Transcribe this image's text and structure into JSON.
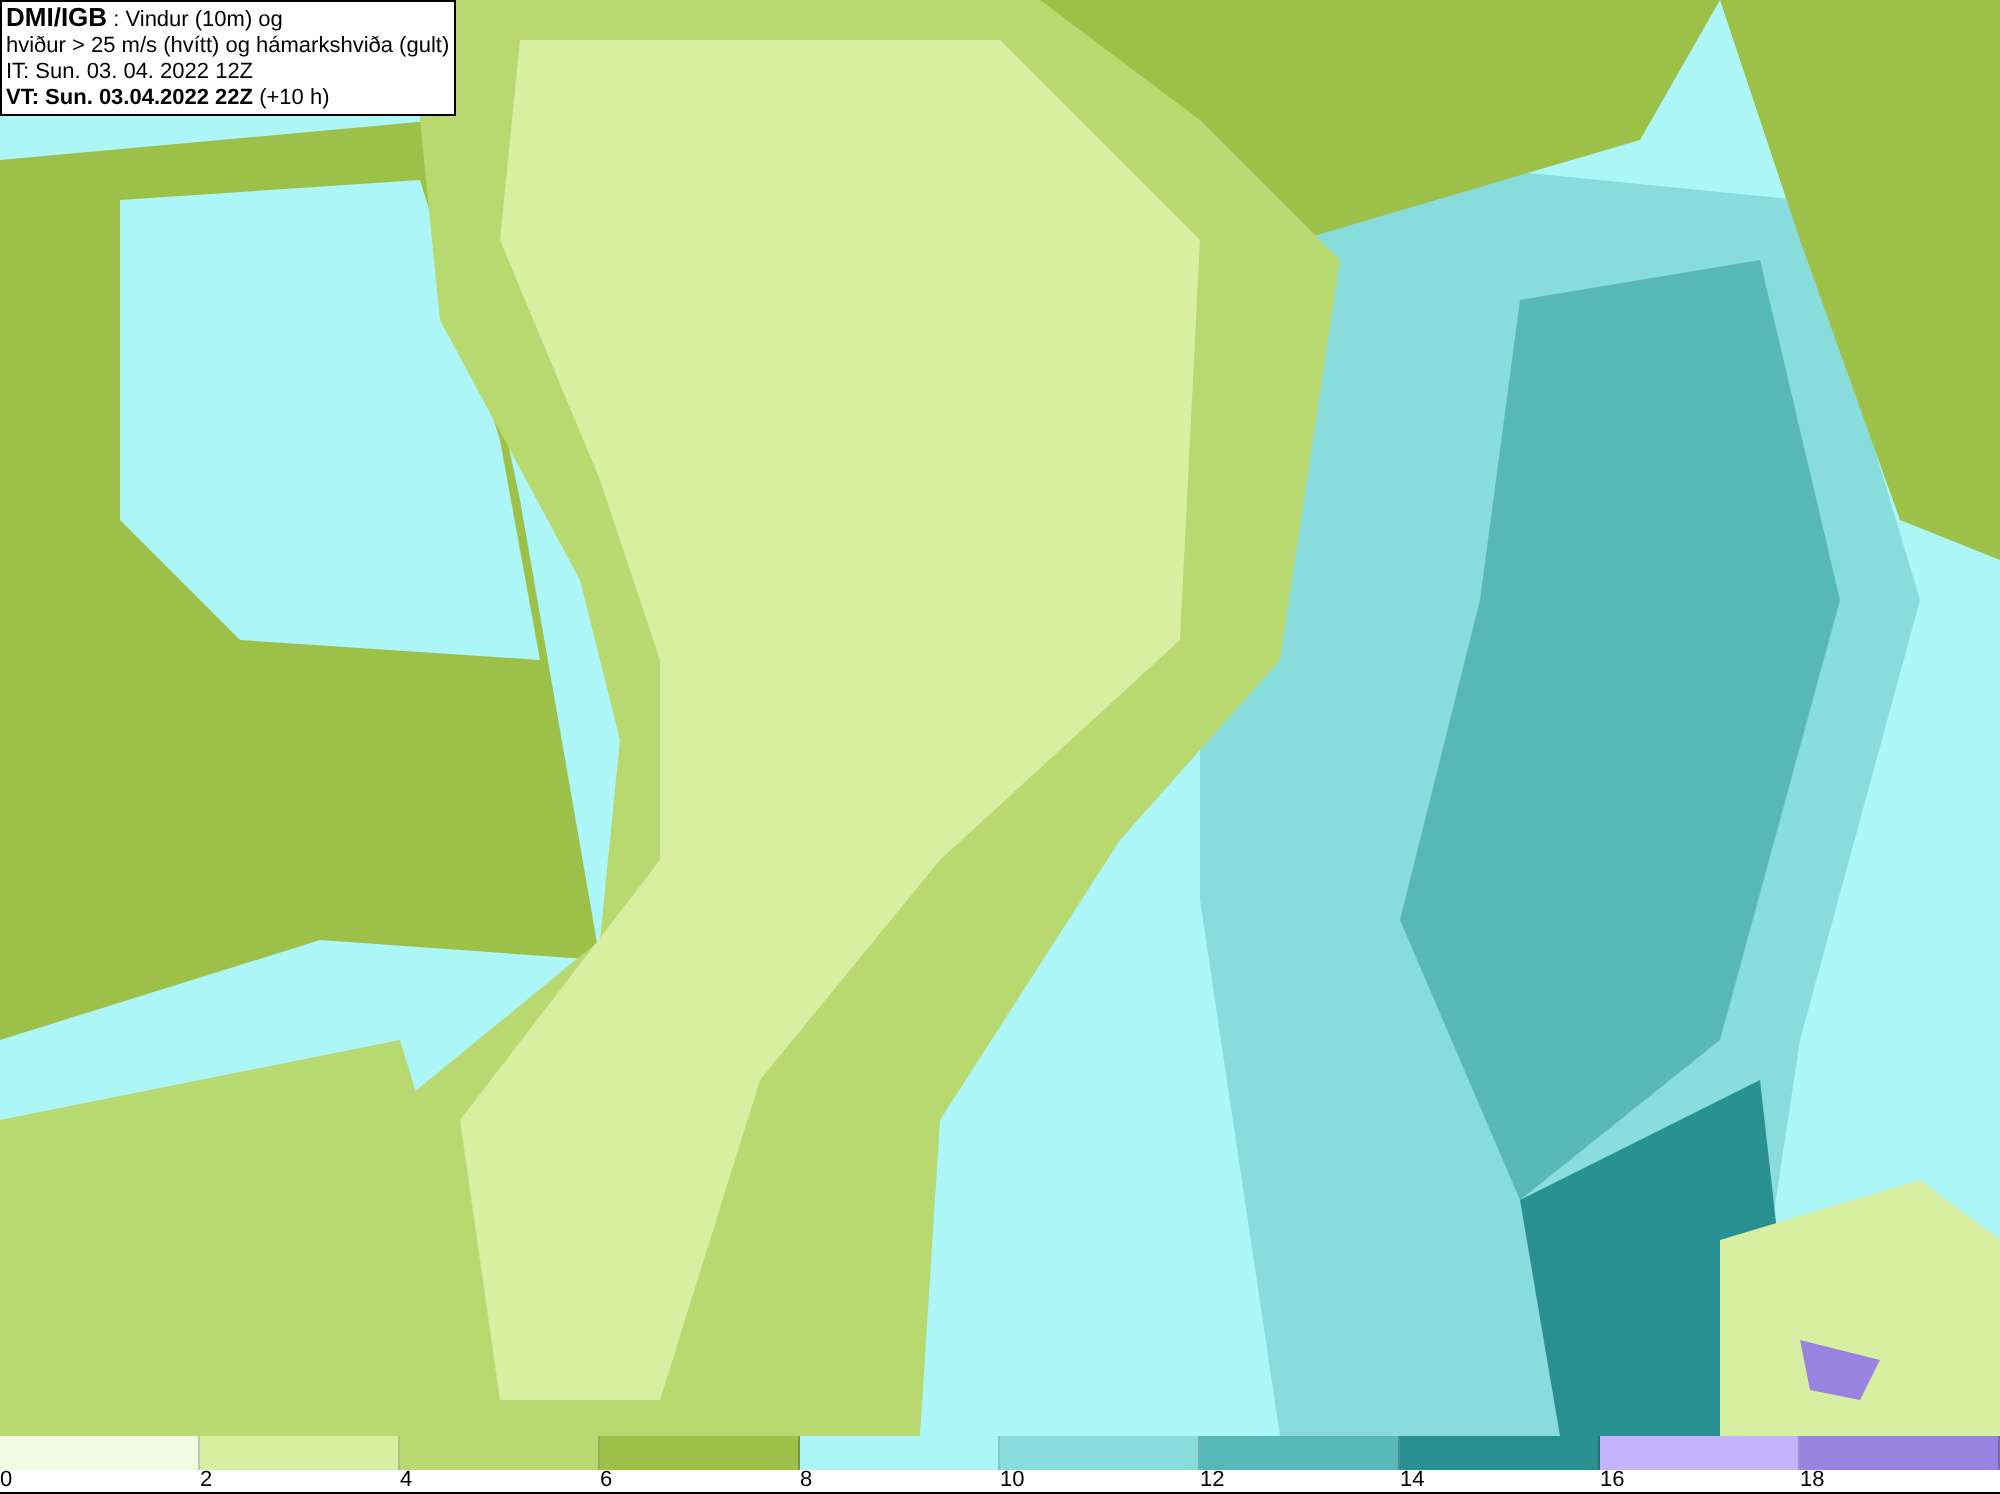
{
  "header": {
    "lines": [
      "**DMI/IGB** : Vindur (10m) og",
      "hviður > 25 m/s (hvítt) og hámarkshviða (gult)",
      "IT: Sun. 03. 04. 2022 12Z",
      "**VT: Sun. 03.04.2022 22Z** (+10 h)"
    ]
  },
  "legend": [
    {
      "label": "0",
      "color": "#f4fae2"
    },
    {
      "label": "2",
      "color": "#d8eea0"
    },
    {
      "label": "4",
      "color": "#b8d870"
    },
    {
      "label": "6",
      "color": "#9cc048"
    },
    {
      "label": "8",
      "color": "#acf6f8"
    },
    {
      "label": "10",
      "color": "#88dcdc"
    },
    {
      "label": "12",
      "color": "#58b8b8"
    },
    {
      "label": "14",
      "color": "#289090"
    },
    {
      "label": "16",
      "color": "#c4b4fc"
    },
    {
      "label": "18",
      "color": "#9884e0"
    }
  ]
}
